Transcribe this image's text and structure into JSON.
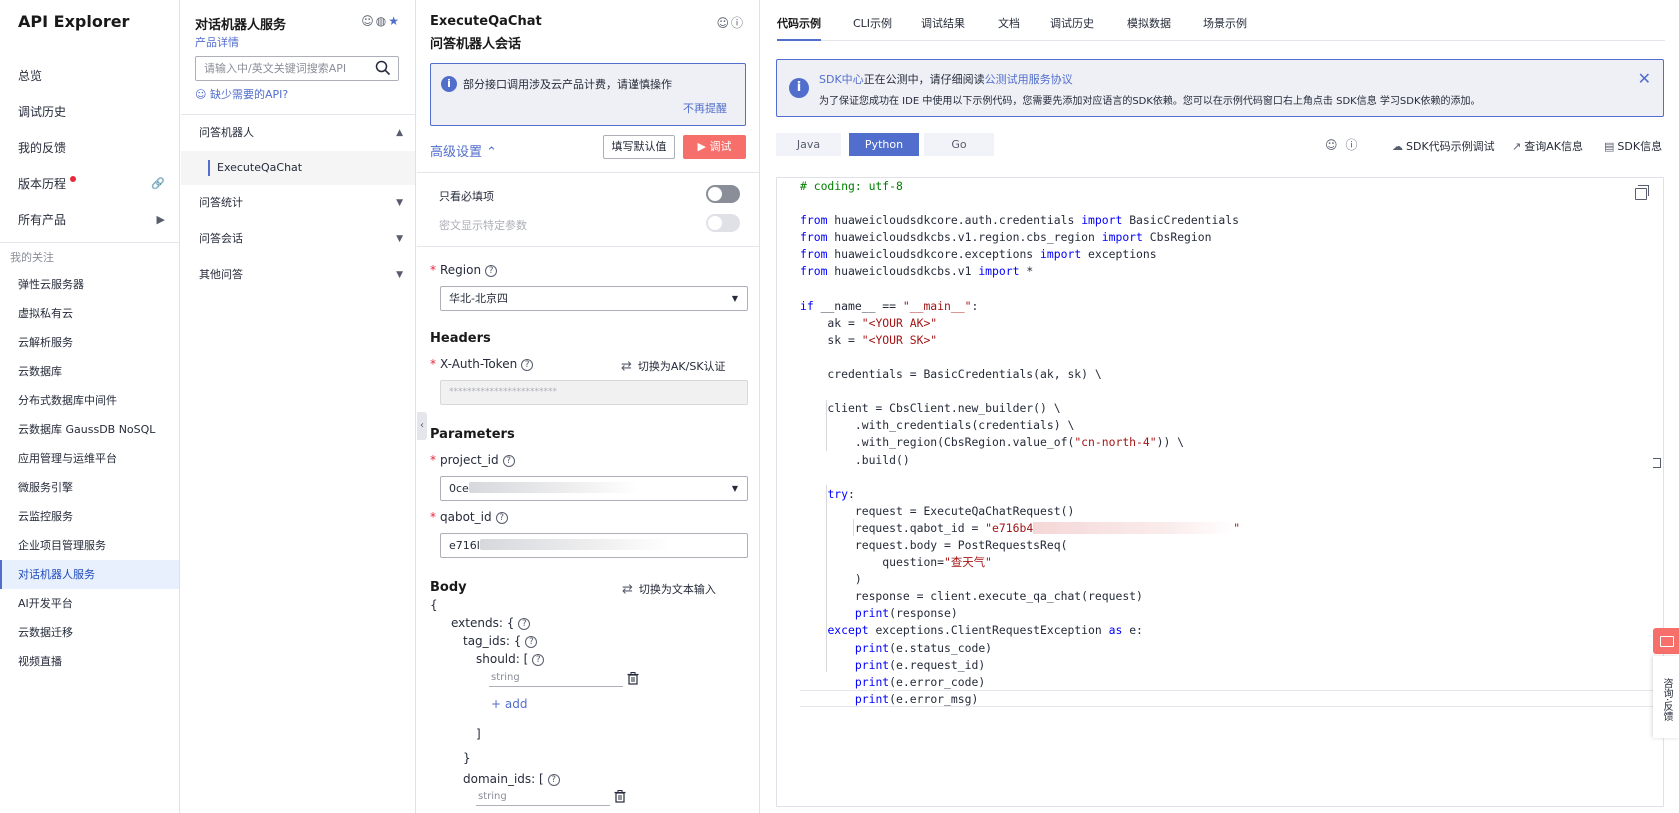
{
  "nav": {
    "brand": "API Explorer",
    "main": [
      {
        "label": "总览"
      },
      {
        "label": "调试历史"
      },
      {
        "label": "我的反馈"
      },
      {
        "label": "版本历程",
        "badge": "dot",
        "right_icon": "link-icon"
      },
      {
        "label": "所有产品",
        "right_icon": "caret-right-icon"
      }
    ],
    "follow_title": "我的关注",
    "follow": [
      "弹性云服务器",
      "虚拟私有云",
      "云解析服务",
      "云数据库",
      "分布式数据库中间件",
      "云数据库 GaussDB NoSQL",
      "应用管理与运维平台",
      "微服务引擎",
      "云监控服务",
      "企业项目管理服务",
      "对话机器人服务",
      "AI开发平台",
      "云数据迁移",
      "视频直播"
    ],
    "follow_active": "对话机器人服务"
  },
  "service": {
    "title": "对话机器人服务",
    "detail_link": "产品详情",
    "search_placeholder": "请输入中/英文关键词搜索API",
    "missing_link": "缺少需要的API?",
    "groups": [
      {
        "label": "问答机器人",
        "expanded": true,
        "items": [
          "ExecuteQaChat"
        ]
      },
      {
        "label": "问答统计",
        "expanded": false
      },
      {
        "label": "问答会话",
        "expanded": false
      },
      {
        "label": "其他问答",
        "expanded": false
      }
    ]
  },
  "request": {
    "api_name": "ExecuteQaChat",
    "api_cn": "问答机器人会话",
    "notice_text": "部分接口调用涉及云产品计费，请谨慎操作",
    "notice_dismiss": "不再提醒",
    "advanced": "高级设置",
    "fill_default": "填写默认值",
    "debug": "调试",
    "only_required": "只看必填项",
    "show_specific": "密文显示特定参数",
    "region_label": "Region",
    "region_value": "华北-北京四",
    "headers_title": "Headers",
    "token_label": "X-Auth-Token",
    "switch_aksk": "切换为AK/SK认证",
    "token_value": "************************",
    "params_title": "Parameters",
    "project_label": "project_id",
    "project_value_prefix": "0ce",
    "qabot_label": "qabot_id",
    "qabot_value_prefix": "e716l",
    "body_title": "Body",
    "switch_text": "切换为文本输入",
    "body_open": "{",
    "extends_label": "extends: {",
    "tag_ids_label": "tag_ids: {",
    "should_label": "should: [",
    "should_placeholder": "string",
    "add_label": "add",
    "close_bracket": "]",
    "close_brace": "}",
    "domain_ids_label": "domain_ids: [",
    "domain_placeholder": "string"
  },
  "code": {
    "tabs": [
      "代码示例",
      "CLI示例",
      "调试结果",
      "文档",
      "调试历史",
      "模拟数据",
      "场景示例"
    ],
    "active_tab": "代码示例",
    "notice_link1": "SDK中心",
    "notice_mid": "正在公测中，请仔细阅读",
    "notice_link2": "公测试用服务协议",
    "notice_line2": "为了保证您成功在 IDE 中使用以下示例代码，您需要先添加对应语言的SDK依赖。您可以在示例代码窗口右上角点击 SDK信息 学习SDK依赖的添加。",
    "langs": [
      "Java",
      "Python",
      "Go"
    ],
    "active_lang": "Python",
    "tools": [
      "SDK代码示例调试",
      "查询AK信息",
      "SDK信息"
    ]
  },
  "feedback": {
    "label": "咨询·反馈"
  },
  "colors": {
    "accent": "#526ecc",
    "debug_button": "#f66f6a",
    "active_nav_bg": "#e8effd",
    "notice_bg": "#eef0f5"
  }
}
